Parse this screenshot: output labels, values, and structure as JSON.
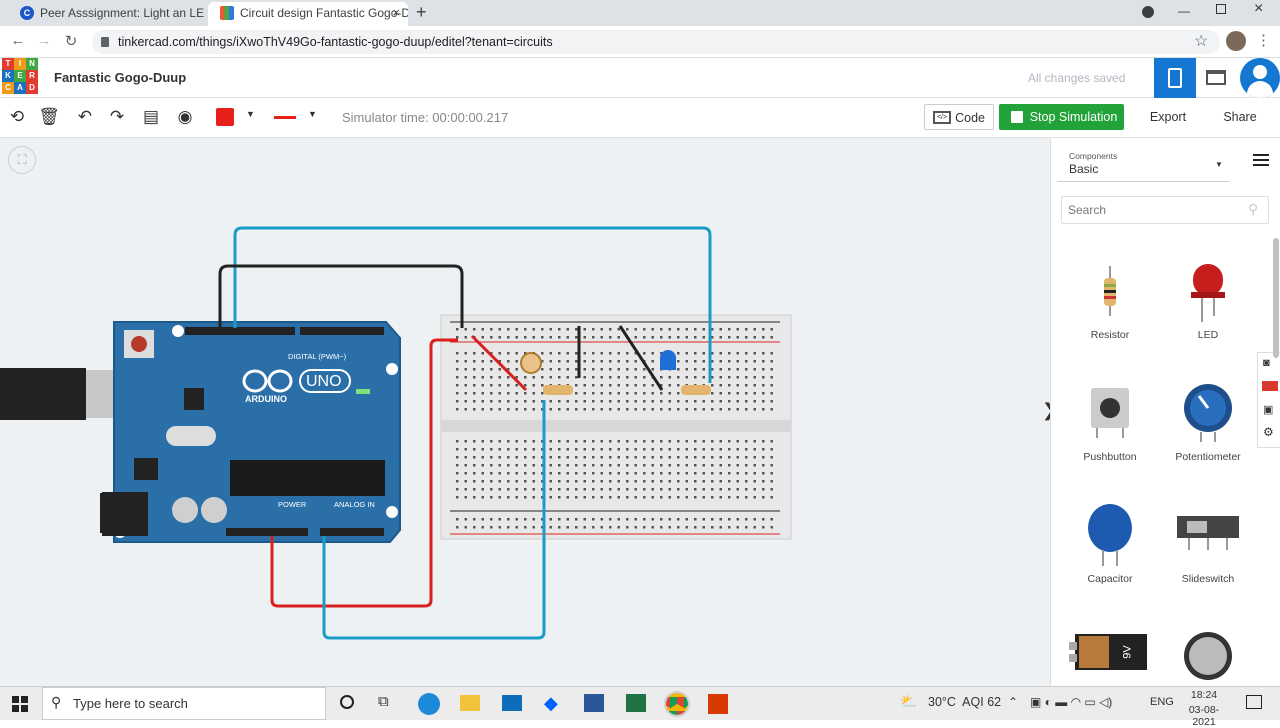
{
  "browser": {
    "tabs": [
      {
        "title": "Peer Asssignment: Light an LED |",
        "close": "×"
      },
      {
        "title": "Circuit design Fantastic Gogo-Du",
        "close": "×"
      }
    ],
    "new_tab": "+",
    "url": "tinkercad.com/things/iXwoThV49Go-fantastic-gogo-duup/editel?tenant=circuits"
  },
  "app": {
    "logo_letters": [
      "T",
      "I",
      "N",
      "K",
      "E",
      "R",
      "C",
      "A",
      "D"
    ],
    "title": "Fantastic Gogo-Duup",
    "save_status": "All changes saved"
  },
  "toolbar": {
    "simulator_time": "Simulator time: 00:00:00.217",
    "code_label": "Code",
    "stop_label": "Stop Simulation",
    "export_label": "Export",
    "share_label": "Share",
    "color_swatch": "#e8201c"
  },
  "board": {
    "arduino_brand": "ARDUINO",
    "uno": "UNO",
    "digital_label": "DIGITAL (PWM~)",
    "power_label": "POWER",
    "analog_label": "ANALOG IN"
  },
  "panel": {
    "components_caption": "Components",
    "components_value": "Basic",
    "search_placeholder": "Search",
    "items": [
      {
        "label": "Resistor"
      },
      {
        "label": "LED"
      },
      {
        "label": "Pushbutton"
      },
      {
        "label": "Potentiometer"
      },
      {
        "label": "Capacitor"
      },
      {
        "label": "Slideswitch"
      }
    ],
    "battery_label": "9V"
  },
  "taskbar": {
    "search_placeholder": "Type here to search",
    "weather": "30°C  AQI 62",
    "language": "ENG",
    "time": "18:24",
    "date": "03-08-2021"
  },
  "colors": {
    "tinkercad_blue": "#1477d1",
    "stop_green": "#21a33a",
    "arduino_blue": "#2a6fa8",
    "wire_blue": "#1a9cc8",
    "wire_red": "#d92020",
    "wire_black": "#222222"
  }
}
